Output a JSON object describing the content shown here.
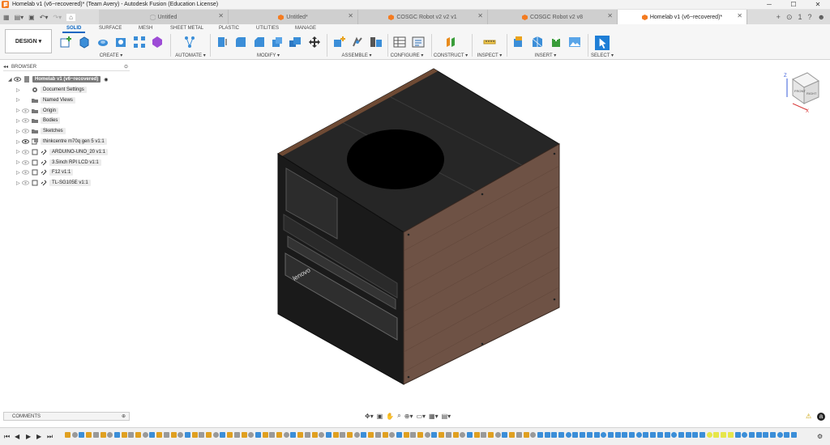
{
  "window": {
    "title": "Homelab v1 (v6~recovered)* (Team Avery) - Autodesk Fusion (Education License)"
  },
  "tabs": [
    {
      "label": "Untitled",
      "active": false
    },
    {
      "label": "Untitled*",
      "active": false
    },
    {
      "label": "COSGC Robot v2 v2 v1",
      "active": false
    },
    {
      "label": "COSGC Robot v2 v8",
      "active": false
    },
    {
      "label": "Homelab v1 (v6~recovered)*",
      "active": true
    }
  ],
  "tab_icons": {
    "plus": "+",
    "offline": "⊙",
    "jobs": "1",
    "help": "?",
    "notify": "☻"
  },
  "toolbar": {
    "workspace": "DESIGN",
    "mode_tabs": [
      "SOLID",
      "SURFACE",
      "MESH",
      "SHEET METAL",
      "PLASTIC",
      "UTILITIES",
      "MANAGE"
    ],
    "active_mode": "SOLID",
    "groups": [
      "CREATE ▾",
      "AUTOMATE ▾",
      "MODIFY ▾",
      "ASSEMBLE ▾",
      "CONFIGURE ▾",
      "CONSTRUCT ▾",
      "INSPECT ▾",
      "INSERT ▾",
      "SELECT ▾"
    ]
  },
  "browser": {
    "title": "BROWSER",
    "root": "Homelab v1 (v6~recovered)",
    "items": [
      {
        "label": "Document Settings",
        "icon": "gear-icon"
      },
      {
        "label": "Named Views",
        "icon": "folder-icon"
      },
      {
        "label": "Origin",
        "icon": "folder-icon"
      },
      {
        "label": "Bodies",
        "icon": "folder-icon"
      },
      {
        "label": "Sketches",
        "icon": "folder-icon"
      },
      {
        "label": "thinkcentre m70q gen 5 v1:1",
        "icon": "component-icon"
      },
      {
        "label": "ARDUINO-UNO_20 v1:1",
        "icon": "link-icon"
      },
      {
        "label": "3.5inch RPI LCD v1:1",
        "icon": "link-icon"
      },
      {
        "label": "F12 v1:1",
        "icon": "link-icon"
      },
      {
        "label": "TL-SG105E v1:1",
        "icon": "link-icon"
      }
    ]
  },
  "viewport": {
    "logo_text": "lenovo",
    "viewcube_labels": [
      "FRONT",
      "RIGHT"
    ],
    "axes": [
      "Z",
      "X"
    ]
  },
  "comments": {
    "label": "COMMENTS"
  },
  "nav_icons": [
    "orbit-icon",
    "pan-icon",
    "zoom-icon",
    "display-icon",
    "grid-icon"
  ],
  "colors": {
    "accent": "#0a66c2",
    "wood": "#6e5245",
    "frame": "#1c1c1c"
  }
}
